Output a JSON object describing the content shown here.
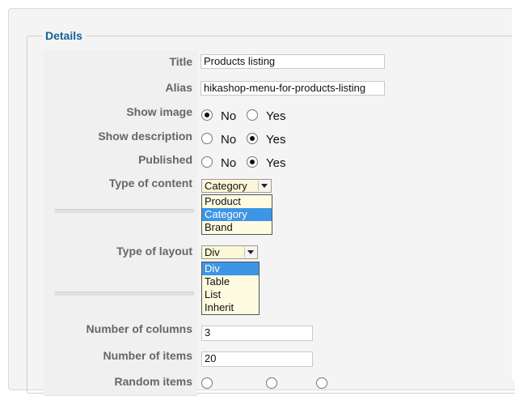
{
  "section": {
    "legend": "Details"
  },
  "fields": {
    "title": {
      "label": "Title",
      "value": "Products listing"
    },
    "alias": {
      "label": "Alias",
      "value": "hikashop-menu-for-products-listing"
    },
    "show_image": {
      "label": "Show image",
      "no": "No",
      "yes": "Yes",
      "selected": "No"
    },
    "show_description": {
      "label": "Show description",
      "no": "No",
      "yes": "Yes",
      "selected": "Yes"
    },
    "published": {
      "label": "Published",
      "no": "No",
      "yes": "Yes",
      "selected": "Yes"
    },
    "type_of_content": {
      "label": "Type of content",
      "value": "Category",
      "options": [
        "Product",
        "Category",
        "Brand"
      ]
    },
    "type_of_layout": {
      "label": "Type of layout",
      "value": "Div",
      "options": [
        "Div",
        "Table",
        "List",
        "Inherit"
      ]
    },
    "number_of_columns": {
      "label": "Number of columns",
      "value": "3"
    },
    "number_of_items": {
      "label": "Number of items",
      "value": "20"
    },
    "random_items": {
      "label": "Random items"
    }
  },
  "colors": {
    "legend": "#146295",
    "selected_option": "#3d95e6",
    "dropdown_bg": "#fffbe0"
  }
}
